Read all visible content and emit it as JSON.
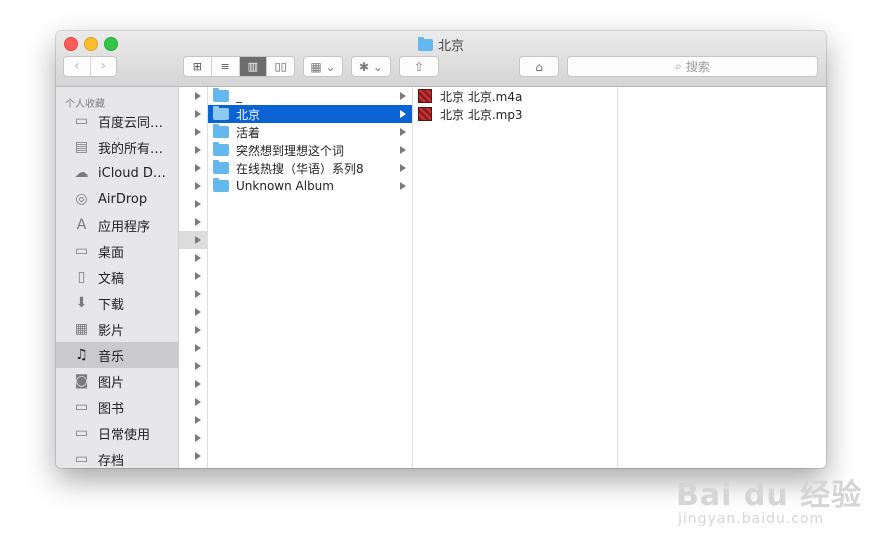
{
  "window": {
    "title": "北京",
    "title_icon": "folder-icon"
  },
  "toolbar": {
    "back_glyph": "‹",
    "forward_glyph": "›",
    "view_icons": [
      "⊞",
      "≡",
      "▥",
      "▯▯"
    ],
    "arrange_icon": "▦ ⌄",
    "action_icon": "✱ ⌄",
    "share_icon": "⇧",
    "tag_icon": "⌂",
    "search_placeholder": "搜索",
    "search_icon": "⌕"
  },
  "sidebar": {
    "section_title": "个人收藏",
    "items": [
      {
        "label": "百度云同…",
        "icon": "folder-icon",
        "glyph": "▭"
      },
      {
        "label": "我的所有…",
        "icon": "all-files-icon",
        "glyph": "▤"
      },
      {
        "label": "iCloud D…",
        "icon": "cloud-icon",
        "glyph": "☁"
      },
      {
        "label": "AirDrop",
        "icon": "airdrop-icon",
        "glyph": "◎"
      },
      {
        "label": "应用程序",
        "icon": "applications-icon",
        "glyph": "A"
      },
      {
        "label": "桌面",
        "icon": "desktop-icon",
        "glyph": "▭"
      },
      {
        "label": "文稿",
        "icon": "documents-icon",
        "glyph": "▯"
      },
      {
        "label": "下载",
        "icon": "downloads-icon",
        "glyph": "⬇"
      },
      {
        "label": "影片",
        "icon": "movies-icon",
        "glyph": "▦"
      },
      {
        "label": "音乐",
        "icon": "music-icon",
        "glyph": "♫"
      },
      {
        "label": "图片",
        "icon": "pictures-icon",
        "glyph": "◙"
      },
      {
        "label": "图书",
        "icon": "folder-icon",
        "glyph": "▭"
      },
      {
        "label": "日常使用",
        "icon": "folder-icon",
        "glyph": "▭"
      },
      {
        "label": "存档",
        "icon": "folder-icon",
        "glyph": "▭"
      }
    ]
  },
  "column1": {
    "items": [
      {
        "label": "_"
      },
      {
        "label": "北京"
      },
      {
        "label": "活着"
      },
      {
        "label": "突然想到理想这个词"
      },
      {
        "label": "在线热搜（华语）系列8"
      },
      {
        "label": "Unknown Album"
      }
    ]
  },
  "column2": {
    "items": [
      {
        "label": "北京 北京.m4a"
      },
      {
        "label": "北京 北京.mp3"
      }
    ]
  },
  "watermark": {
    "main": "Bai du 经验",
    "sub": "jingyan.baidu.com"
  }
}
